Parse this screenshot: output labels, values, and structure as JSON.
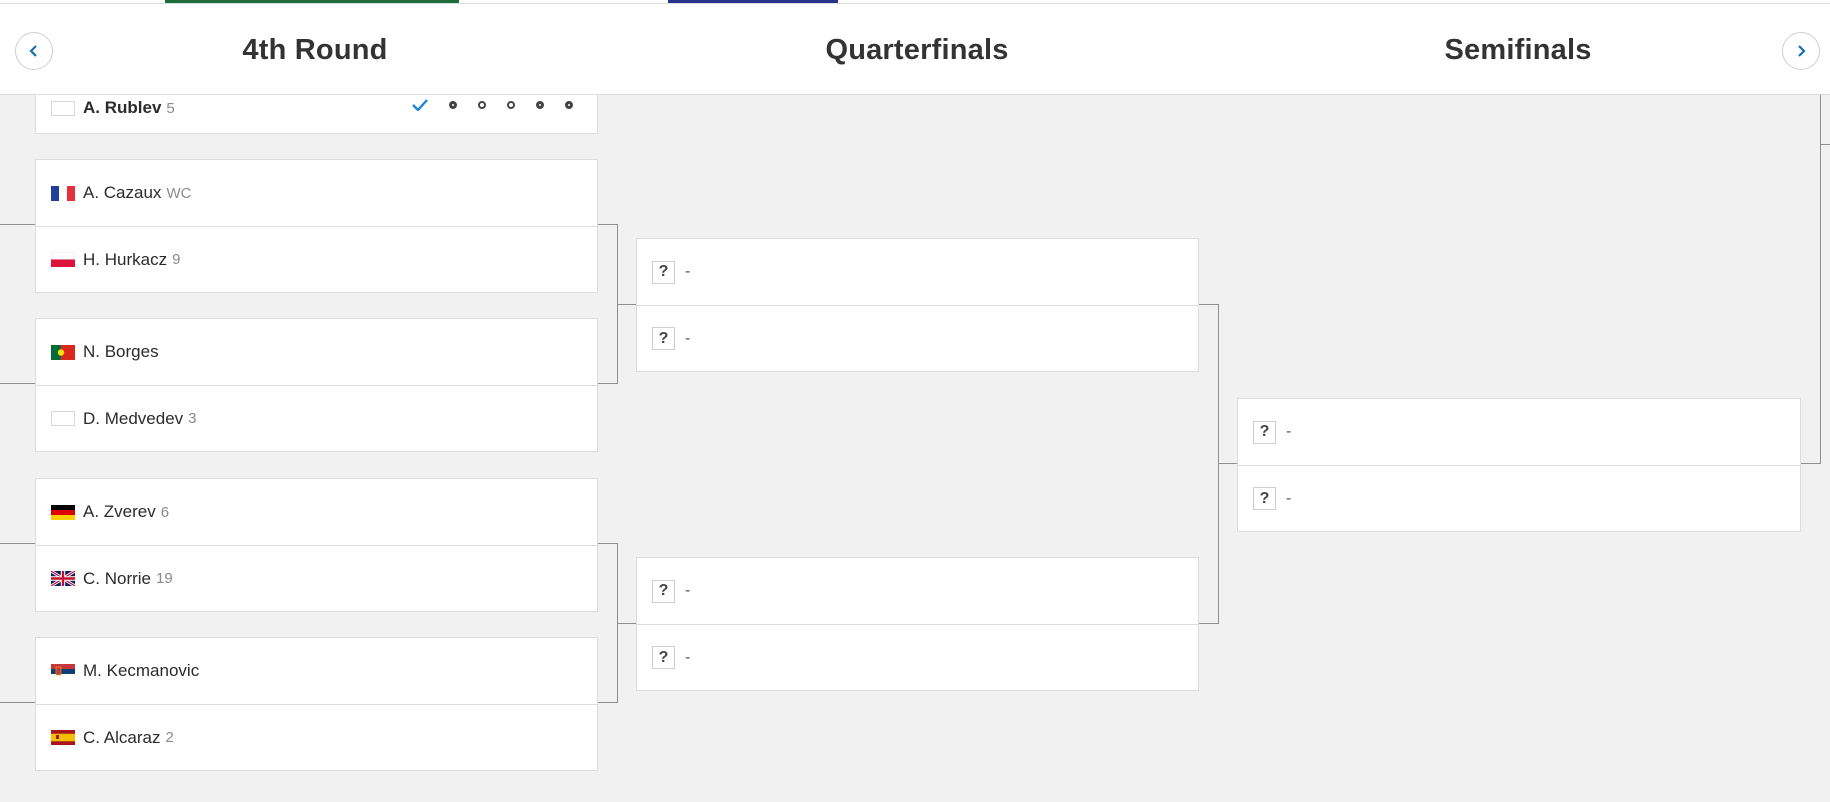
{
  "header": {
    "rounds": [
      "4th Round",
      "Quarterfinals",
      "Semifinals"
    ],
    "prev_label": "previous rounds",
    "next_label": "next rounds"
  },
  "colors": {
    "accent_green": "#1f6b3a",
    "accent_blue": "#26348b"
  },
  "r16": {
    "partial": {
      "name": "A. Rublev",
      "seed": "5",
      "flag": "blank-flag-icon"
    },
    "matches": [
      [
        {
          "name": "A. Cazaux",
          "seed": "WC",
          "flag": "france-flag-icon"
        },
        {
          "name": "H. Hurkacz",
          "seed": "9",
          "flag": "poland-flag-icon"
        }
      ],
      [
        {
          "name": "N. Borges",
          "seed": "",
          "flag": "portugal-flag-icon"
        },
        {
          "name": "D. Medvedev",
          "seed": "3",
          "flag": "blank-flag-icon"
        }
      ],
      [
        {
          "name": "A. Zverev",
          "seed": "6",
          "flag": "germany-flag-icon"
        },
        {
          "name": "C. Norrie",
          "seed": "19",
          "flag": "uk-flag-icon"
        }
      ],
      [
        {
          "name": "M. Kecmanovic",
          "seed": "",
          "flag": "serbia-flag-icon"
        },
        {
          "name": "C. Alcaraz",
          "seed": "2",
          "flag": "spain-flag-icon"
        }
      ]
    ]
  },
  "tbd": {
    "symbol": "?",
    "placeholder": "-"
  }
}
